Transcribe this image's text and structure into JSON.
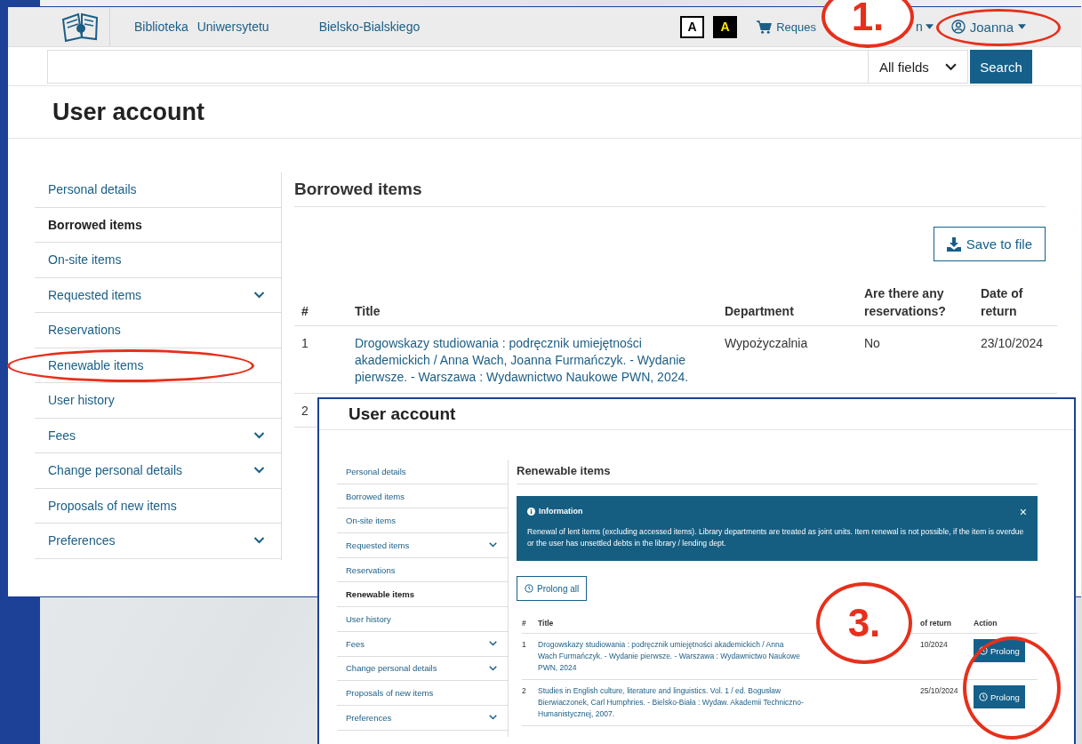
{
  "header": {
    "links": [
      "Biblioteka",
      "Uniwersytetu",
      "Bielsko-Bialskiego"
    ],
    "contrast_buttons": [
      {
        "label": "A",
        "kind": "normal"
      },
      {
        "label": "A",
        "kind": "high"
      }
    ],
    "cart_link": "Reques",
    "partial_menu": "n",
    "user_menu": "Joanna"
  },
  "search": {
    "scope": "All fields",
    "button": "Search"
  },
  "page_title": "User account",
  "sidebar": {
    "items": [
      {
        "label": "Personal details",
        "selected": false,
        "has_submenu": false
      },
      {
        "label": "Borrowed items",
        "selected": true,
        "has_submenu": false
      },
      {
        "label": "On-site items",
        "selected": false,
        "has_submenu": false
      },
      {
        "label": "Requested items",
        "selected": false,
        "has_submenu": true
      },
      {
        "label": "Reservations",
        "selected": false,
        "has_submenu": false
      },
      {
        "label": "Renewable items",
        "selected": false,
        "has_submenu": false
      },
      {
        "label": "User history",
        "selected": false,
        "has_submenu": false
      },
      {
        "label": "Fees",
        "selected": false,
        "has_submenu": true
      },
      {
        "label": "Change personal details",
        "selected": false,
        "has_submenu": true
      },
      {
        "label": "Proposals of new items",
        "selected": false,
        "has_submenu": false
      },
      {
        "label": "Preferences",
        "selected": false,
        "has_submenu": true
      }
    ]
  },
  "section_title": "Borrowed items",
  "save_button": "Save to file",
  "table": {
    "columns": [
      "#",
      "Title",
      "Department",
      "Are there any reservations?",
      "Date of return"
    ],
    "rows": [
      {
        "number": "1",
        "title": "Drogowskazy studiowania : podręcznik umiejętności akademickich / Anna Wach, Joanna Furmańczyk. - Wydanie pierwsze. - Warszawa : Wydawnictwo Naukowe PWN, 2024.",
        "department": "Wypożyczalnia",
        "reservations": "No",
        "date": "23/10/2024"
      },
      {
        "number": "2"
      }
    ]
  },
  "inset": {
    "page_title": "User account",
    "sidebar": {
      "items": [
        {
          "label": "Personal details",
          "selected": false,
          "has_submenu": false
        },
        {
          "label": "Borrowed items",
          "selected": false,
          "has_submenu": false
        },
        {
          "label": "On-site items",
          "selected": false,
          "has_submenu": false
        },
        {
          "label": "Requested items",
          "selected": false,
          "has_submenu": true
        },
        {
          "label": "Reservations",
          "selected": false,
          "has_submenu": false
        },
        {
          "label": "Renewable items",
          "selected": true,
          "has_submenu": false
        },
        {
          "label": "User history",
          "selected": false,
          "has_submenu": false
        },
        {
          "label": "Fees",
          "selected": false,
          "has_submenu": true
        },
        {
          "label": "Change personal details",
          "selected": false,
          "has_submenu": true
        },
        {
          "label": "Proposals of new items",
          "selected": false,
          "has_submenu": false
        },
        {
          "label": "Preferences",
          "selected": false,
          "has_submenu": true
        }
      ]
    },
    "section_title": "Renewable items",
    "info": {
      "title": "Information",
      "close": "×",
      "text": "Renewal of lent items (excluding accessed items). Library departments are treated as joint units. Item renewal is not possible, if the item is overdue or the user has unsettled debts in the library / lending dept."
    },
    "prolong_all": "Prolong all",
    "table": {
      "columns": [
        "#",
        "Title",
        "of return",
        "Action"
      ],
      "rows": [
        {
          "number": "1",
          "title": "Drogowskazy studiowania : podręcznik umiejętności akademickich / Anna Wach Furmańczyk. - Wydanie pierwsze. - Warszawa : Wydawnictwo Naukowe PWN, 2024",
          "date": "10/2024",
          "action": "Prolong"
        },
        {
          "number": "2",
          "title": "Studies in English culture, literature and linguistics. Vol. 1 / ed. Bogusław Bierwiaczonek, Carl Humphries. - Bielsko-Biała : Wydaw. Akademii Techniczno-Humanistycznej, 2007.",
          "date": "25/10/2024",
          "action": "Prolong"
        }
      ]
    }
  },
  "annotations": [
    {
      "label": "1.",
      "kind": "number"
    },
    {
      "kind": "ellipse"
    },
    {
      "kind": "ellipse"
    },
    {
      "label": "3.",
      "kind": "number"
    },
    {
      "kind": "ellipse"
    }
  ]
}
